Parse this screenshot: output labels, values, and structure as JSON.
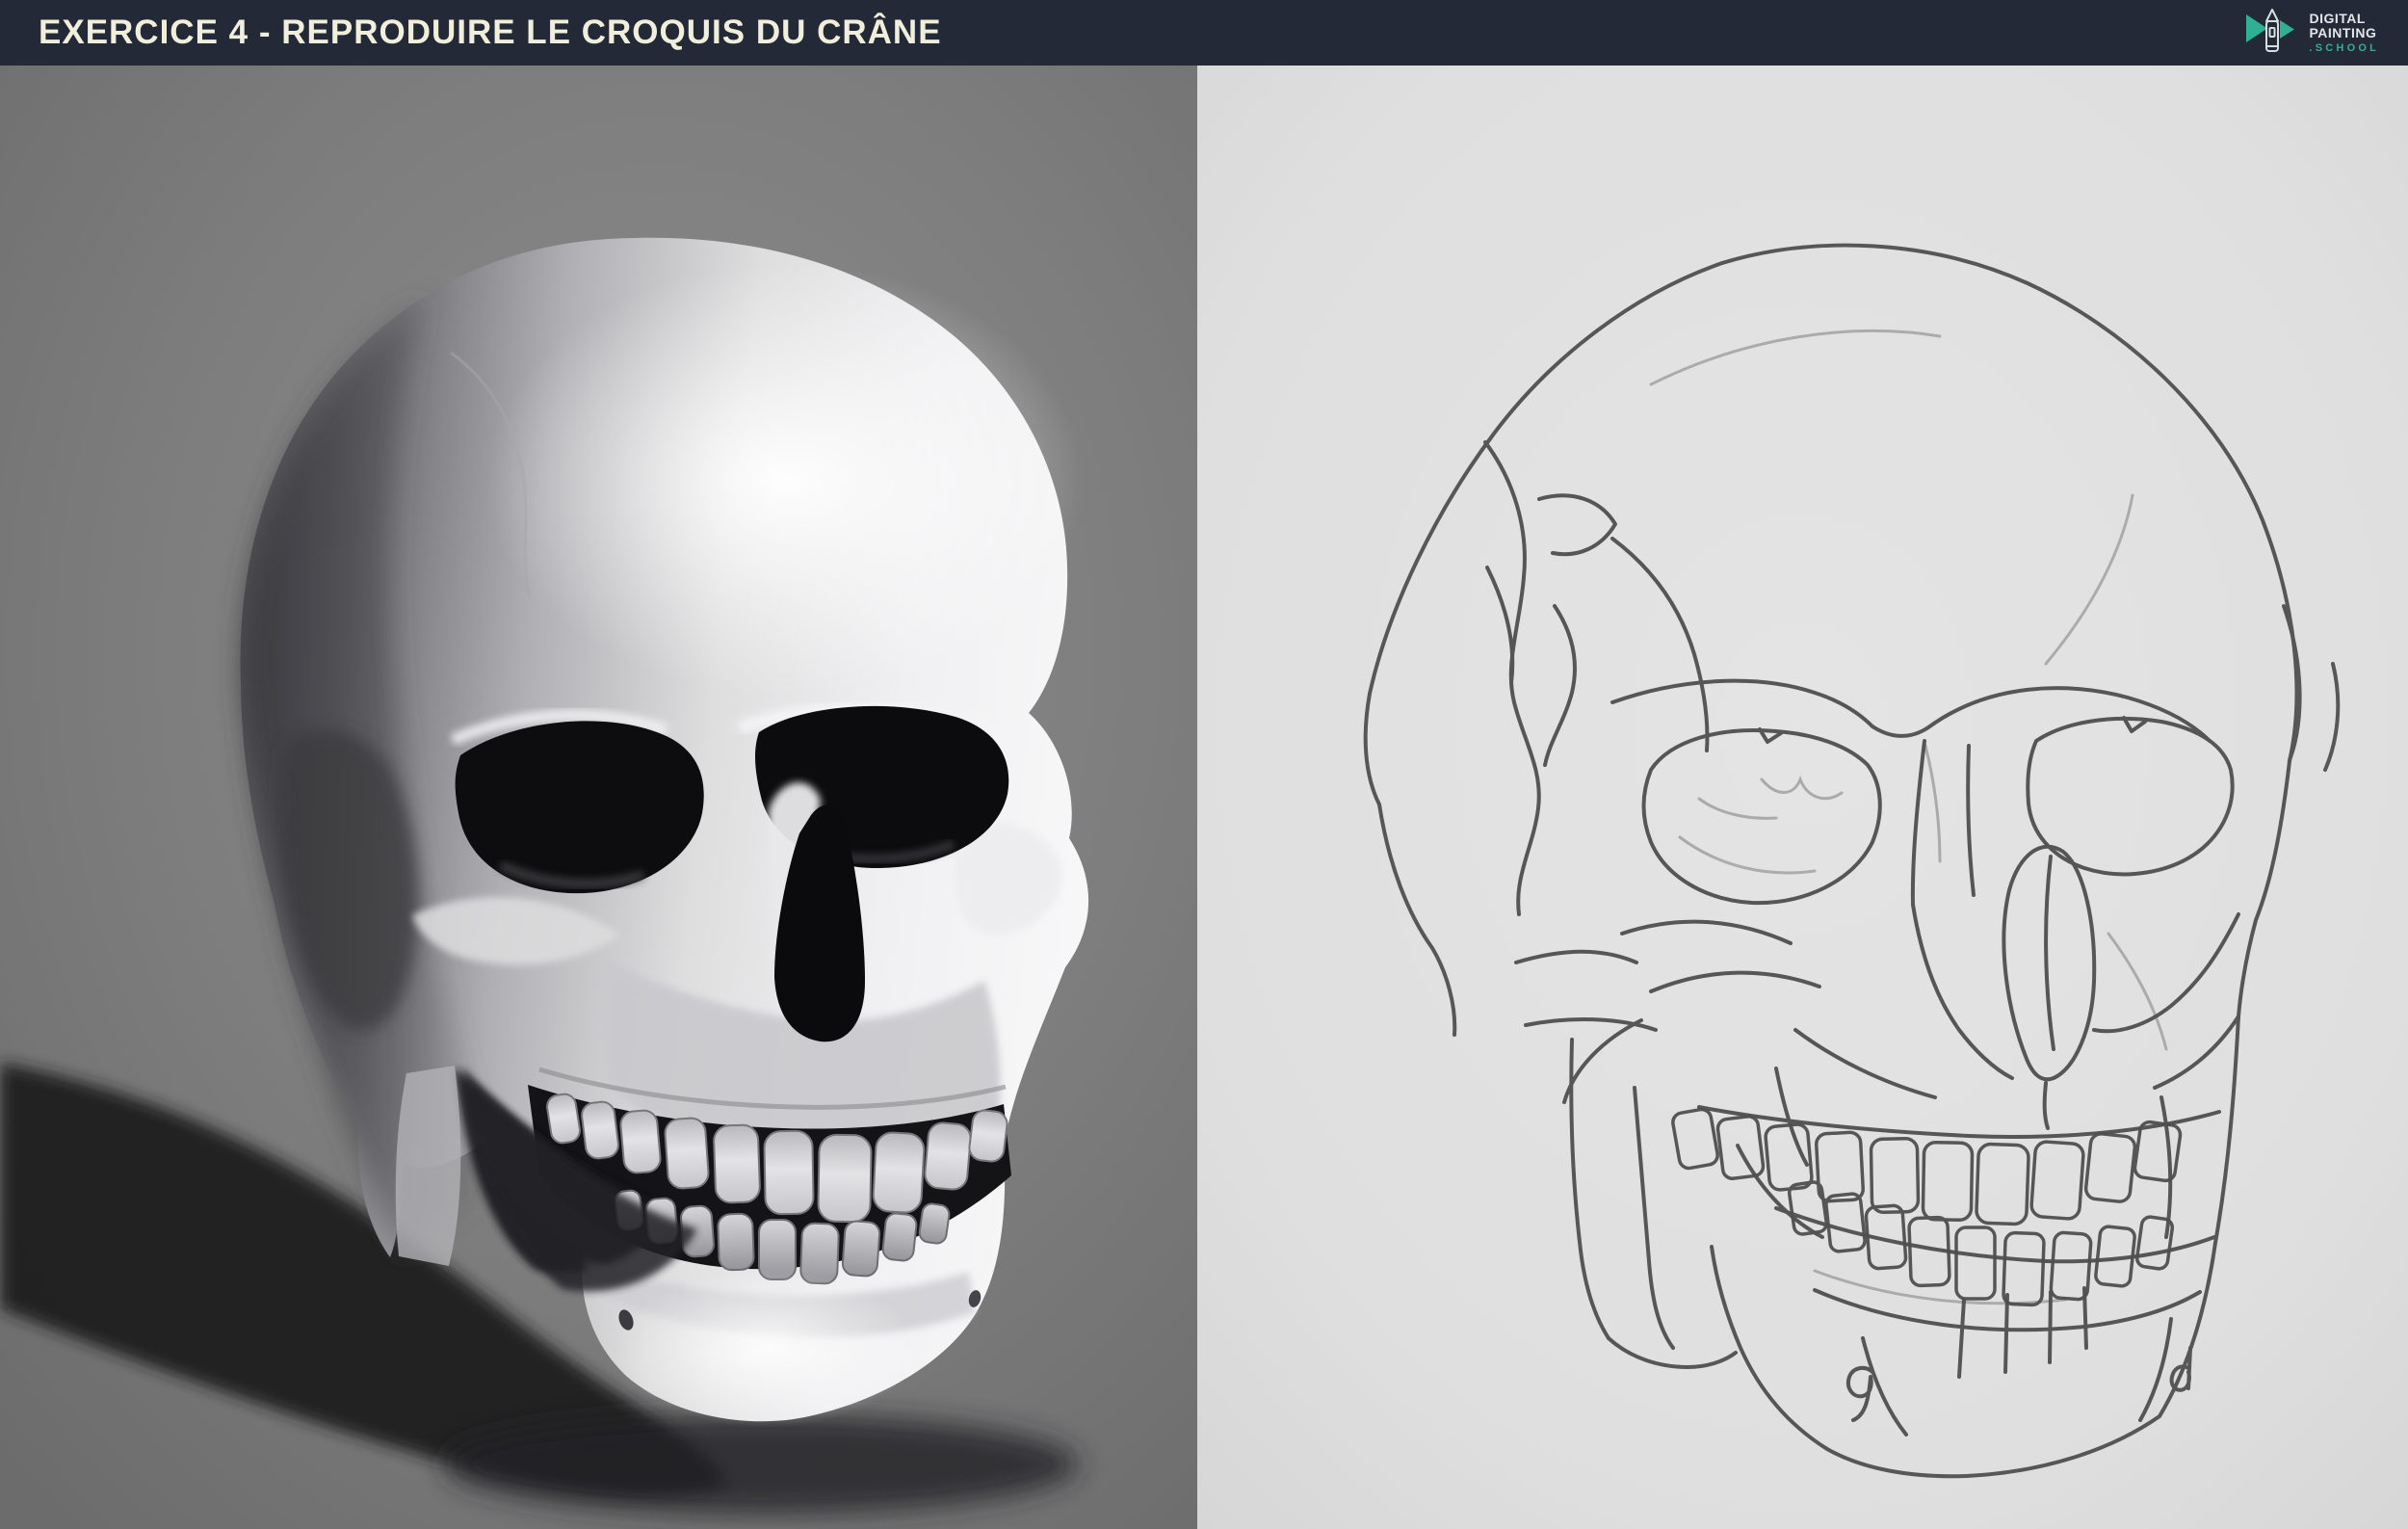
{
  "header": {
    "title": "EXERCICE 4 - REPRODUIRE LE CROQUIS DU CRÂNE",
    "logo": {
      "icon": "pencil-icon",
      "line1": "DIGITAL",
      "line2": "PAINTING",
      "line3": ".SCHOOL"
    }
  },
  "colors": {
    "header_bg": "#232936",
    "title_text": "#f1eedb",
    "logo_teal": "#2fb093",
    "logo_text": "#e3e7e9",
    "left_panel_bg": "#7d7d7d",
    "right_panel_bg": "#e0e0e0",
    "cast_shadow": "#1b1b1d",
    "sketch_line": "#4f4f4f"
  }
}
